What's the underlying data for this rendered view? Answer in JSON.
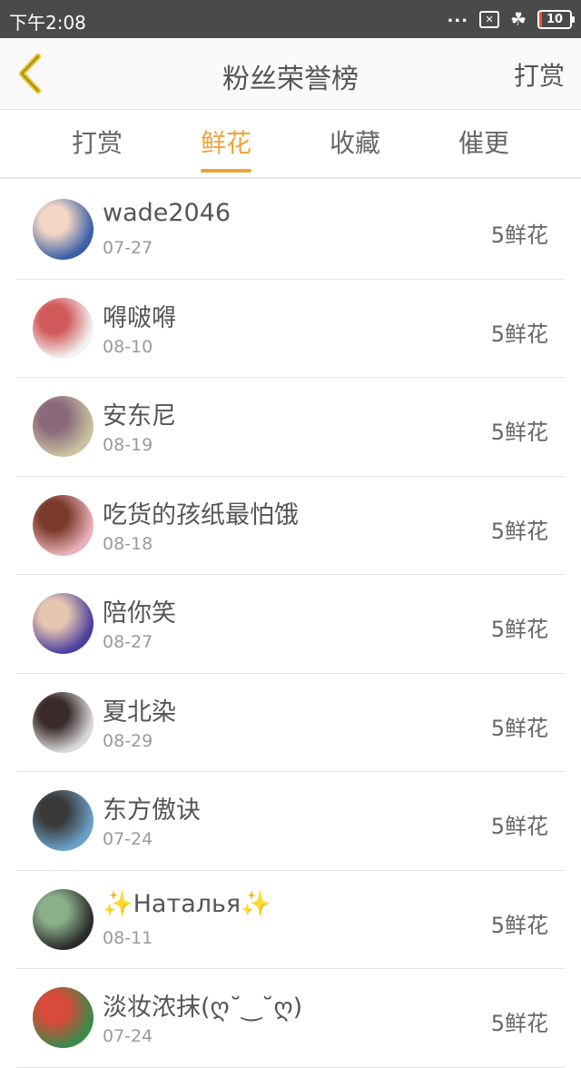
{
  "status_bar": {
    "time": "下午2:08",
    "dots": "...",
    "battery_level": "10",
    "battery_fraction": 0.1
  },
  "header": {
    "title": "粉丝荣誉榜",
    "action": "打赏"
  },
  "tabs": [
    {
      "label": "打赏",
      "active": false
    },
    {
      "label": "鲜花",
      "active": true
    },
    {
      "label": "收藏",
      "active": false
    },
    {
      "label": "催更",
      "active": false
    }
  ],
  "colors": {
    "accent": "#f0a33a",
    "back_icon": "#e8c21a",
    "status_bar_bg": "#4a4a4a"
  },
  "fans": [
    {
      "name": "wade2046",
      "date": "07-27",
      "amount": "5鲜花",
      "avatar_colors": [
        "#3a5fa8",
        "#f4d6c4"
      ]
    },
    {
      "name": "嘚啵嘚",
      "date": "08-10",
      "amount": "5鲜花",
      "avatar_colors": [
        "#f2f2f2",
        "#d35a5a"
      ]
    },
    {
      "name": "安东尼",
      "date": "08-19",
      "amount": "5鲜花",
      "avatar_colors": [
        "#c9c1a0",
        "#8a6a7a"
      ]
    },
    {
      "name": "吃货的孩纸最怕饿",
      "date": "08-18",
      "amount": "5鲜花",
      "avatar_colors": [
        "#e8b0b8",
        "#7a3a2a"
      ]
    },
    {
      "name": "陪你笑",
      "date": "08-27",
      "amount": "5鲜花",
      "avatar_colors": [
        "#4b3fa0",
        "#e7c6b0"
      ]
    },
    {
      "name": "夏北染",
      "date": "08-29",
      "amount": "5鲜花",
      "avatar_colors": [
        "#d8d8d8",
        "#3a2a2a"
      ]
    },
    {
      "name": "东方傲诀",
      "date": "07-24",
      "amount": "5鲜花",
      "avatar_colors": [
        "#6aa0c8",
        "#3a3a3a"
      ]
    },
    {
      "name": "✨Наталья✨",
      "date": "08-11",
      "amount": "5鲜花",
      "avatar_colors": [
        "#2a2a2a",
        "#8ab08a"
      ]
    },
    {
      "name": "淡妆浓抹(ღ˘‿˘ღ)",
      "date": "07-24",
      "amount": "5鲜花",
      "avatar_colors": [
        "#3a8a4a",
        "#d84a3a"
      ]
    }
  ]
}
